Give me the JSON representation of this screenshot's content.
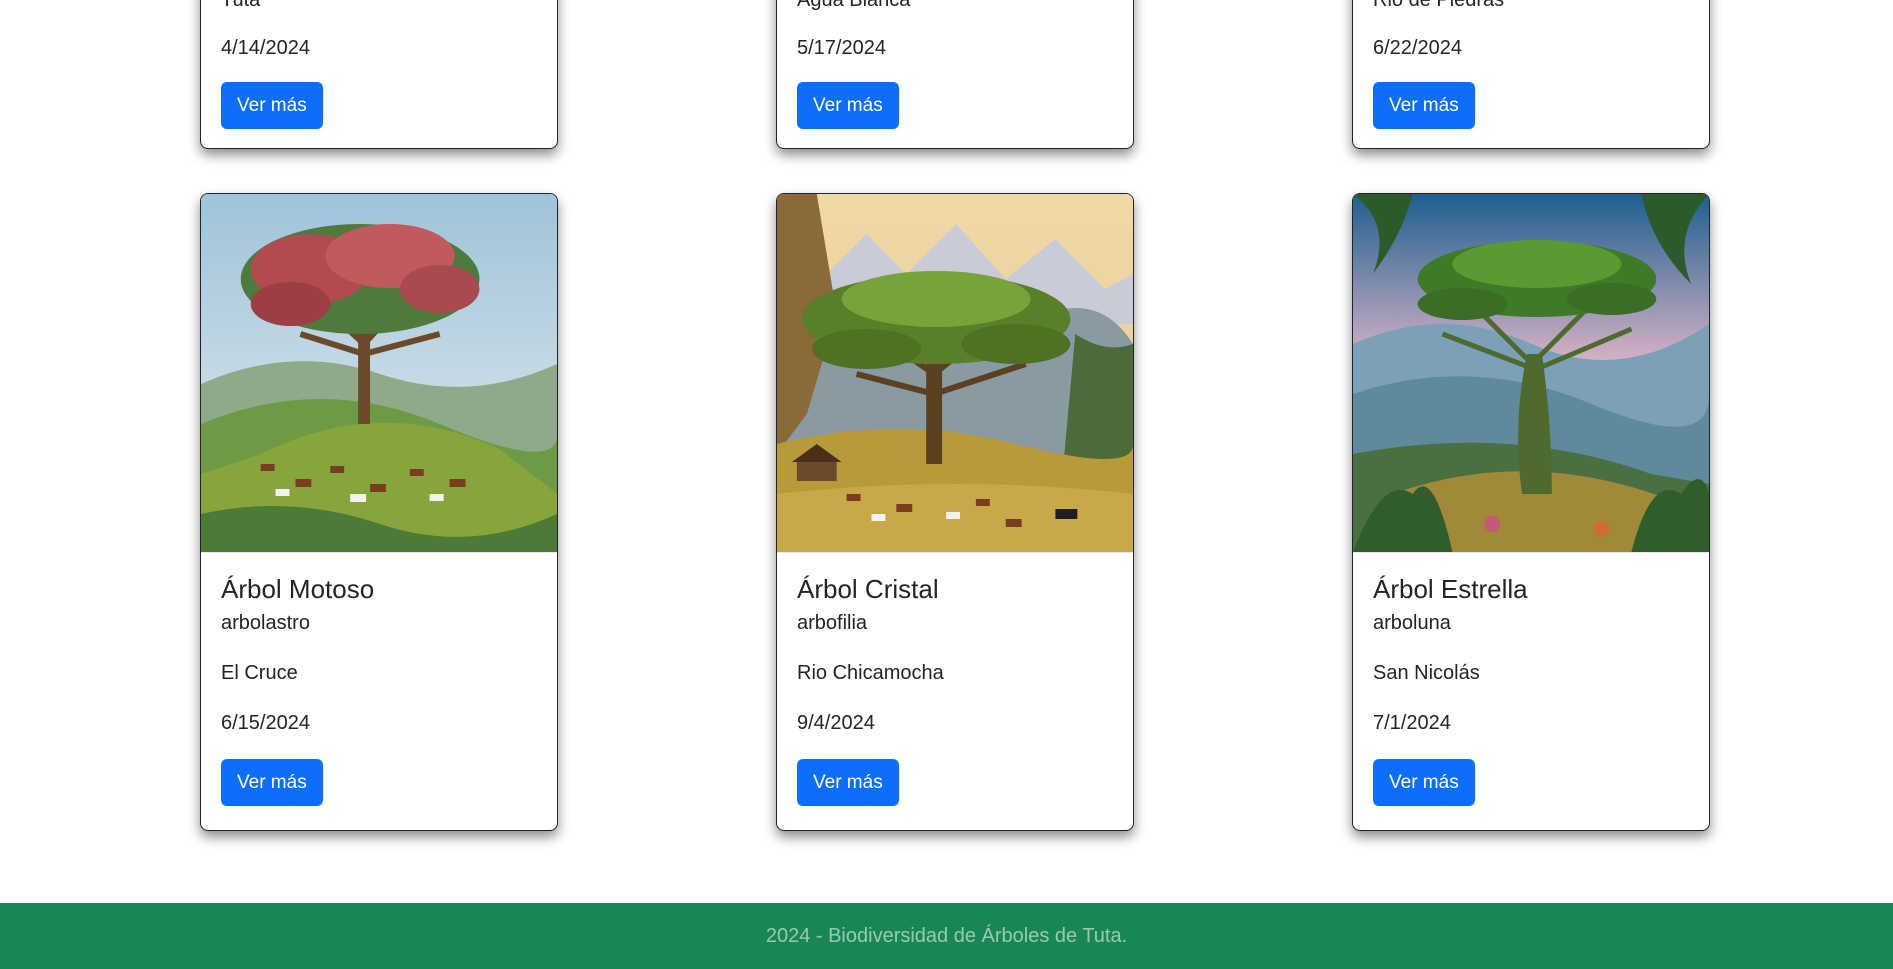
{
  "top_cards": [
    {
      "location": "Tuta",
      "date": "4/14/2024",
      "button_label": "Ver más"
    },
    {
      "location": "Agua Blanca",
      "date": "5/17/2024",
      "button_label": "Ver más"
    },
    {
      "location": "Rio de Piedras",
      "date": "6/22/2024",
      "button_label": "Ver más"
    }
  ],
  "cards": [
    {
      "title": "Árbol Motoso",
      "species": "arbolastro",
      "location": "El Cruce",
      "date": "6/15/2024",
      "button_label": "Ver más"
    },
    {
      "title": "Árbol Cristal",
      "species": "arbofilia",
      "location": "Rio Chicamocha",
      "date": "9/4/2024",
      "button_label": "Ver más"
    },
    {
      "title": "Árbol Estrella",
      "species": "arboluna",
      "location": "San Nicolás",
      "date": "7/1/2024",
      "button_label": "Ver más"
    }
  ],
  "footer": {
    "text": "2024 - Biodiversidad de Árboles de Tuta."
  },
  "colors": {
    "primary": "#0d6efd",
    "footer_bg": "#198754"
  }
}
